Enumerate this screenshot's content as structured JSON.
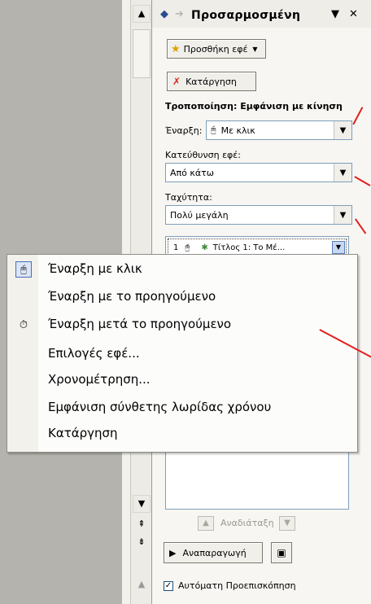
{
  "pane": {
    "title": "Προσαρμοσμένη",
    "add_effect": "Προσθήκη εφέ",
    "remove": "Κατάργηση",
    "modify_heading": "Τροποποίηση: Εμφάνιση με κίνηση",
    "start_label": "Έναρξη:",
    "start_value": "Με κλικ",
    "direction_label": "Κατεύθυνση εφέ:",
    "direction_value": "Από κάτω",
    "speed_label": "Ταχύτητα:",
    "speed_value": "Πολύ μεγάλη",
    "list_item_number": "1",
    "list_item_text": "Τίτλος 1: Το Μέ...",
    "reorder_label": "Αναδιάταξη",
    "play_label": "Αναπαραγωγή",
    "autopreview_label": "Αυτόματη Προεπισκόπηση"
  },
  "menu": {
    "items": [
      "Έναρξη με κλικ",
      "Έναρξη με το προηγούμενο",
      "Έναρξη μετά το προηγούμενο",
      "Επιλογές εφέ...",
      "Χρονομέτρηση...",
      "Εμφάνιση σύνθετης λωρίδας χρόνου",
      "Κατάργηση"
    ]
  },
  "icons": {
    "back": "back-arrow-icon",
    "forward": "forward-arrow-icon",
    "dropdown": "chevron-down-icon",
    "close": "close-icon",
    "mouse": "mouse-icon",
    "clock": "clock-icon",
    "star": "star-icon",
    "play": "play-icon",
    "slideshow": "slideshow-icon"
  },
  "colors": {
    "annotation": "#e0201b",
    "pane_background": "#f7f6f2",
    "left_background": "#b5b3ad"
  }
}
